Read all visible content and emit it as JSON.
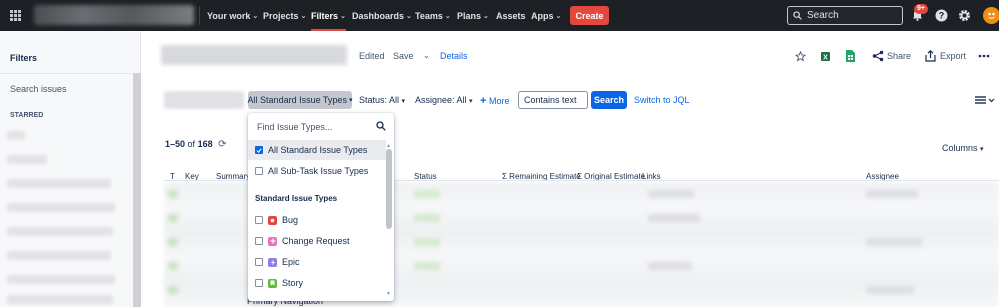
{
  "nav": {
    "items": [
      {
        "label": "Your work",
        "has_chevron": true
      },
      {
        "label": "Projects",
        "has_chevron": true
      },
      {
        "label": "Filters",
        "has_chevron": true,
        "active": true
      },
      {
        "label": "Dashboards",
        "has_chevron": true
      },
      {
        "label": "Teams",
        "has_chevron": true
      },
      {
        "label": "Plans",
        "has_chevron": true
      },
      {
        "label": "Assets",
        "has_chevron": false
      },
      {
        "label": "Apps",
        "has_chevron": true
      }
    ],
    "create_label": "Create",
    "search_placeholder": "Search",
    "notification_count": "9+",
    "colors": {
      "bar": "#1d2125",
      "create": "#e2483d",
      "accent": "#0c66e4"
    }
  },
  "sidebar": {
    "title": "Filters",
    "search_label": "Search issues",
    "starred_label": "STARRED"
  },
  "header": {
    "edited_label": "Edited",
    "save_label": "Save",
    "details_label": "Details",
    "share_label": "Share",
    "export_label": "Export"
  },
  "filterbar": {
    "issue_types_label": "All Standard Issue Types",
    "status_label": "Status: All",
    "assignee_label": "Assignee: All",
    "more_label": "More",
    "contains_value": "Contains text",
    "search_button": "Search",
    "switch_jql": "Switch to JQL"
  },
  "results": {
    "range": "1–50",
    "of_label": "of",
    "total": "168",
    "columns_label": "Columns",
    "headers": {
      "t": "T",
      "key": "Key",
      "summary": "Summary",
      "status": "Status",
      "remaining": "Σ Remaining Estimate",
      "original": "Σ Original Estimate",
      "links": "Links",
      "assignee": "Assignee"
    },
    "peek_text": "Primary Navigation"
  },
  "dropdown": {
    "find_placeholder": "Find Issue Types...",
    "options": [
      {
        "label": "All Standard Issue Types",
        "checked": true
      },
      {
        "label": "All Sub-Task Issue Types",
        "checked": false
      }
    ],
    "section_label": "Standard Issue Types",
    "types": [
      {
        "label": "Bug",
        "icon": "bug-icon",
        "color": "#e2483d",
        "checked": false
      },
      {
        "label": "Change Request",
        "icon": "change-request-icon",
        "color": "#e774bb",
        "checked": false
      },
      {
        "label": "Epic",
        "icon": "epic-icon",
        "color": "#8f7ee7",
        "checked": false
      },
      {
        "label": "Story",
        "icon": "story-icon",
        "color": "#63ba3c",
        "checked": false
      }
    ]
  }
}
